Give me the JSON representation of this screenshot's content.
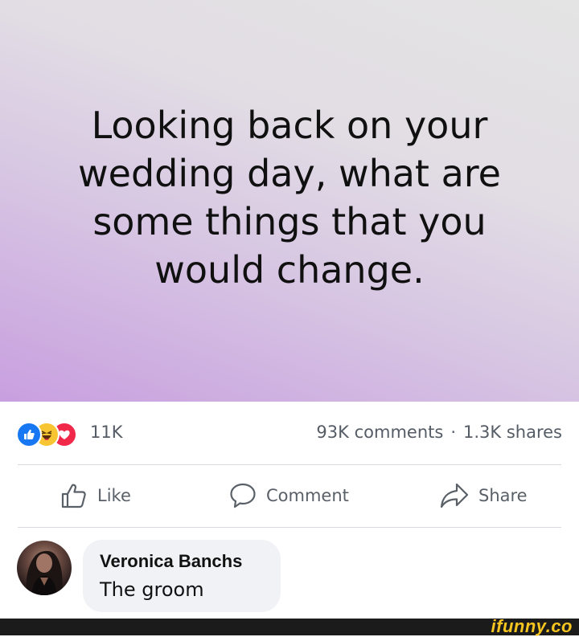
{
  "post": {
    "text": "Looking back on your wedding day, what are some things that you would change."
  },
  "stats": {
    "reaction_icons": [
      "like-icon",
      "haha-icon",
      "love-icon"
    ],
    "reaction_count": "11K",
    "comments": "93K comments",
    "separator": "·",
    "shares": "1.3K shares"
  },
  "actions": {
    "like_label": "Like",
    "comment_label": "Comment",
    "share_label": "Share"
  },
  "comment": {
    "author": "Veronica Banchs",
    "text": "The groom"
  },
  "watermark": {
    "text": "ifunny.co"
  },
  "colors": {
    "like_blue": "#1877f2",
    "haha_yellow": "#f7c531",
    "love_red": "#f0284a",
    "watermark_yellow": "#f6c51f"
  }
}
